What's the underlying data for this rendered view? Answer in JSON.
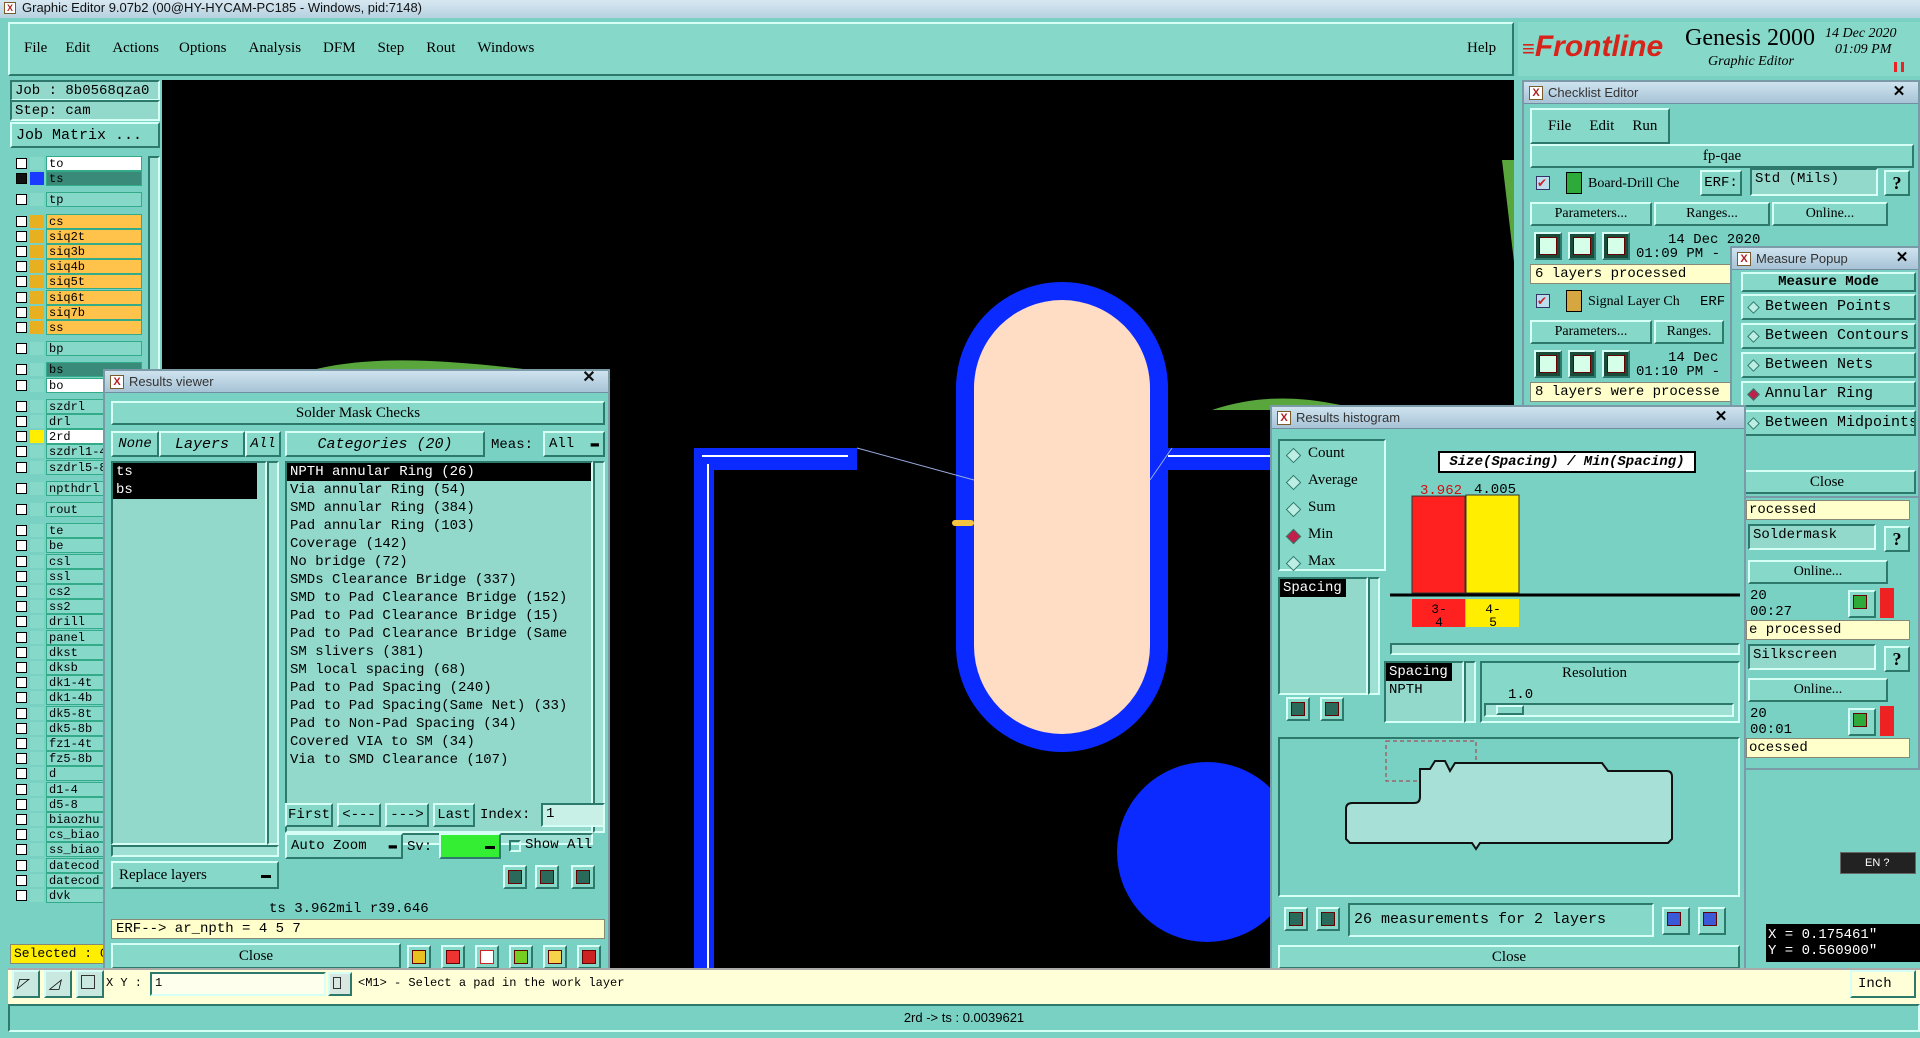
{
  "window_title": "Graphic Editor 9.07b2 (00@HY-HYCAM-PC185 - Windows, pid:7148)",
  "menu": [
    "File",
    "Edit",
    "Actions",
    "Options",
    "Analysis",
    "DFM",
    "Step",
    "Rout",
    "Windows"
  ],
  "help": "Help",
  "brand": {
    "logo": "Frontline",
    "product": "Genesis 2000",
    "subtitle": "Graphic Editor",
    "date": "14 Dec 2020",
    "time": "01:09 PM"
  },
  "job": {
    "job": "Job : 8b0568qza0",
    "step": "Step: cam",
    "matrix_button": "Job Matrix ..."
  },
  "layers": [
    "to",
    "ts",
    "tp",
    "cs",
    "siq2t",
    "siq3b",
    "siq4b",
    "siq5t",
    "siq6t",
    "siq7b",
    "ss",
    "bp",
    "bs",
    "bo",
    "szdrl",
    "drl",
    "2rd",
    "szdrl1-4",
    "szdrl5-8",
    "npthdrl",
    "rout",
    "te",
    "be",
    "csl",
    "ssl",
    "cs2",
    "ss2",
    "drill",
    "panel",
    "dkst",
    "dksb",
    "dk1-4t",
    "dk1-4b",
    "dk5-8t",
    "dk5-8b",
    "fz1-4t",
    "fz5-8b",
    "d",
    "d1-4",
    "d5-8",
    "biaozhu",
    "cs_biao",
    "ss_biao",
    "datecod",
    "datecod",
    "dvk"
  ],
  "selected_label": "Selected : 0",
  "results_viewer": {
    "title": "Results viewer",
    "header": "Solder Mask Checks",
    "none": "None",
    "layers": "Layers",
    "all": "All",
    "categories_label": "Categories (20)",
    "meas_label": "Meas:",
    "meas_value": "All",
    "layer_list": [
      "ts",
      "bs"
    ],
    "categories": [
      "NPTH annular Ring (26)",
      "Via annular Ring (54)",
      "SMD annular Ring (384)",
      "Pad annular Ring (103)",
      "Coverage (142)",
      "No bridge (72)",
      "SMDs Clearance Bridge (337)",
      "SMD to Pad Clearance Bridge (152)",
      "Pad to Pad Clearance Bridge (15)",
      "Pad to Pad Clearance Bridge (Same",
      "SM slivers (381)",
      "SM local spacing (68)",
      "Pad to Pad Spacing (240)",
      "Pad to Pad Spacing(Same Net) (33)",
      "Pad to Non-Pad Spacing (34)",
      "Covered VIA to SM (34)",
      "Via to SMD Clearance (107)"
    ],
    "first": "First",
    "prev": "<---",
    "next": "--->",
    "last": "Last",
    "index_label": "Index:",
    "index_value": "1",
    "auto_zoom": "Auto Zoom",
    "sv": "Sv:",
    "show_all": "Show All",
    "replace_layers": "Replace layers",
    "status": "ts 3.962mil  r39.646",
    "erf": "ERF--> ar_npth = 4 5 7",
    "close": "Close"
  },
  "checklist": {
    "title": "Checklist Editor",
    "menu": [
      "File",
      "Edit",
      "Run"
    ],
    "name": "fp-qae",
    "check1": {
      "name": "Board-Drill Che",
      "erf": "ERF:",
      "erf_value": "Std (Mils)",
      "params": "Parameters...",
      "ranges": "Ranges...",
      "online": "Online...",
      "date": "14 Dec 2020",
      "time": "01:09 PM -",
      "status": "6 layers processed"
    },
    "check2": {
      "name": "Signal Layer Ch",
      "erf": "ERF",
      "params": "Parameters...",
      "ranges": "Ranges.",
      "date": "14 Dec",
      "time": "01:10 PM -",
      "status": "8 layers were processe"
    },
    "peek": {
      "processed1": "rocessed",
      "soldermask": "Soldermask",
      "online1": "Online...",
      "date1": "20",
      "time1": "00:27",
      "processed2": "e processed",
      "silkscreen": "Silkscreen",
      "online2": "Online...",
      "date2": "20",
      "time2": "00:01",
      "processed3": "ocessed"
    },
    "help": "?"
  },
  "measure": {
    "title": "Measure Popup",
    "mode": "Measure Mode",
    "options": [
      "Between Points",
      "Between Contours",
      "Between Nets",
      "Annular Ring",
      "Between Midpoints"
    ],
    "selected": "Annular Ring",
    "close": "Close"
  },
  "histogram": {
    "title": "Results histogram",
    "stats": [
      "Count",
      "Average",
      "Sum",
      "Min",
      "Max"
    ],
    "selected_stat": "Min",
    "list_item": "Spacing",
    "chart_title": "Size(Spacing) / Min(Spacing)",
    "sel_list": [
      "Spacing",
      "NPTH"
    ],
    "resolution_label": "Resolution",
    "resolution": "1.0",
    "summary": "26 measurements for 2 layers",
    "close": "Close"
  },
  "chart_data": {
    "type": "bar",
    "title": "Size(Spacing) / Min(Spacing)",
    "categories": [
      "3-4",
      "4-5"
    ],
    "values": [
      3.962,
      4.005
    ],
    "value_labels": [
      "3.962",
      "4.005"
    ],
    "colors": [
      "#ff2020",
      "#ffee00"
    ]
  },
  "statusbar": {
    "xy_label": "X Y :",
    "xy_value": "1",
    "prompt": "<M1> - Select a pad in the work layer",
    "unit": "Inch",
    "bottom": "2rd -> ts : 0.0039621",
    "coord_x": "X = 0.175461\"",
    "coord_y": "Y = 0.560900\"",
    "lang": "EN"
  },
  "colors": {
    "panel": "#79d1c4",
    "canvas": "#000000",
    "pad": "#ffdcc4",
    "mask": "#0a2aff",
    "titlebar": "#b6d1e0"
  }
}
